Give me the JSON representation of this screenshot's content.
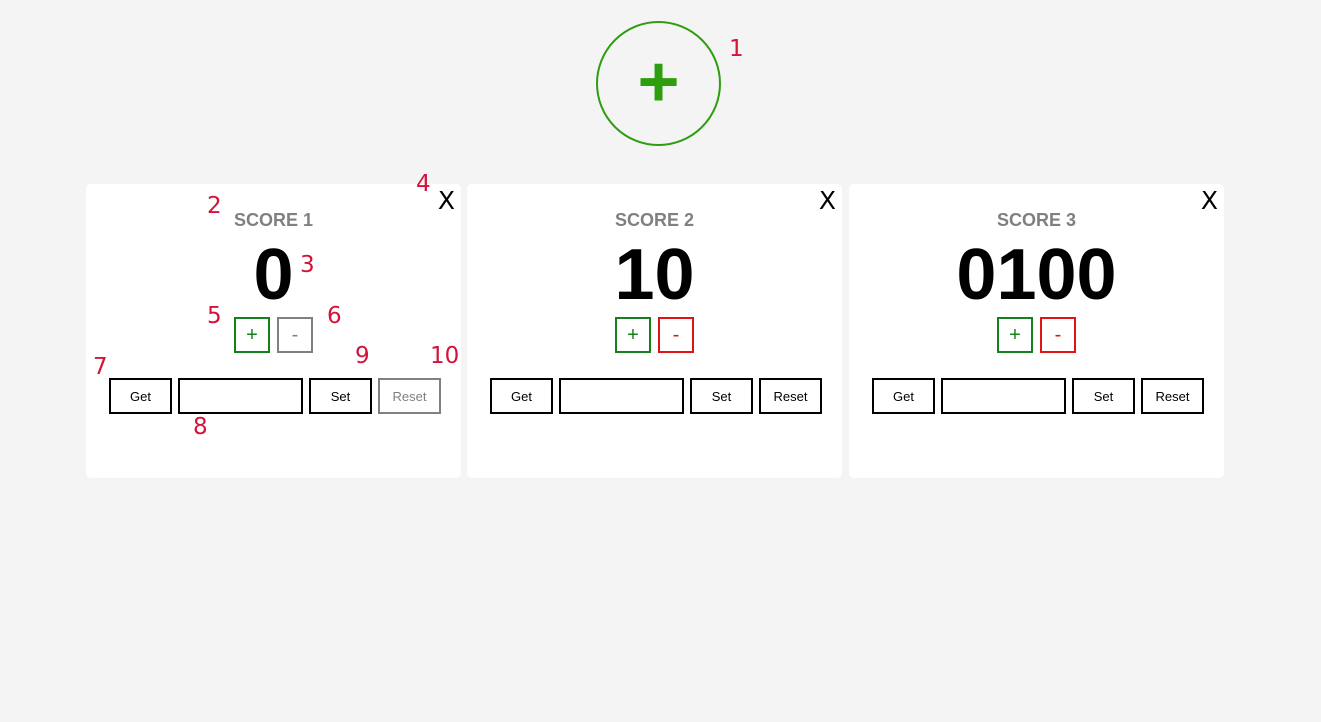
{
  "add_button": {
    "label": "+"
  },
  "annotations": [
    "1",
    "2",
    "3",
    "4",
    "5",
    "6",
    "7",
    "8",
    "9",
    "10"
  ],
  "colors": {
    "accent_green": "#2e9e0e",
    "plus_green": "#14801b",
    "minus_red": "#e01414",
    "disabled_gray": "#808080",
    "annotation_red": "#d4123a"
  },
  "cards": [
    {
      "title": "SCORE 1",
      "value": "0",
      "close": "X",
      "plus": "+",
      "minus": "-",
      "minus_disabled": true,
      "get": "Get",
      "input_value": "",
      "set": "Set",
      "reset": "Reset",
      "reset_disabled": true
    },
    {
      "title": "SCORE 2",
      "value": "10",
      "close": "X",
      "plus": "+",
      "minus": "-",
      "minus_disabled": false,
      "get": "Get",
      "input_value": "",
      "set": "Set",
      "reset": "Reset",
      "reset_disabled": false
    },
    {
      "title": "SCORE 3",
      "value": "0100",
      "close": "X",
      "plus": "+",
      "minus": "-",
      "minus_disabled": false,
      "get": "Get",
      "input_value": "",
      "set": "Set",
      "reset": "Reset",
      "reset_disabled": false
    }
  ]
}
